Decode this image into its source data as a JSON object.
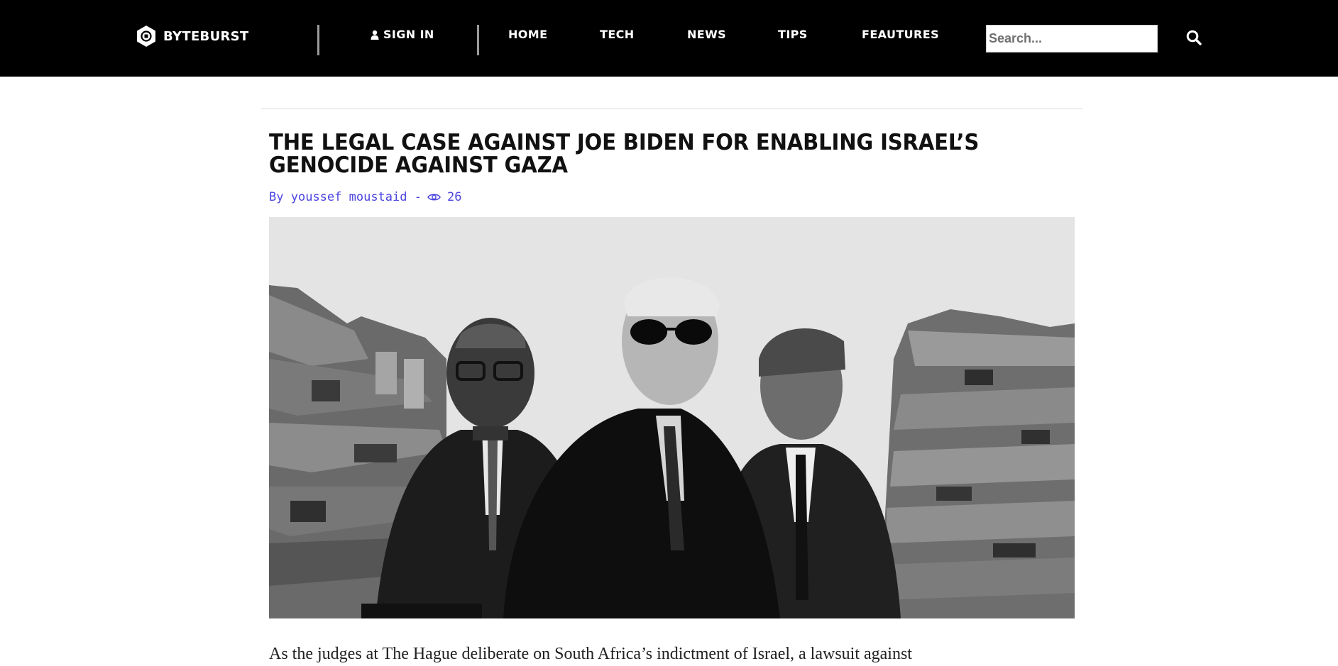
{
  "header": {
    "logo_text": "BYTEBURST",
    "sign_in_label": "SIGN IN",
    "nav": [
      "HOME",
      "TECH",
      "NEWS",
      "TIPS",
      "FEAUTURES"
    ],
    "search_placeholder": "Search...",
    "colors": {
      "bar": "#000000",
      "text": "#ffffff"
    }
  },
  "article": {
    "title": "THE LEGAL CASE AGAINST JOE BIDEN FOR ENABLING ISRAEL’S GENOCIDE AGAINST GAZA",
    "byline_prefix": "By",
    "author": "youssef moustaid",
    "separator": "-",
    "views": "26",
    "views_icon": "eye-icon",
    "byline_color": "#4b44e0",
    "first_paragraph": "As the judges at The Hague deliberate on South Africa’s indictment of Israel, a lawsuit against"
  }
}
